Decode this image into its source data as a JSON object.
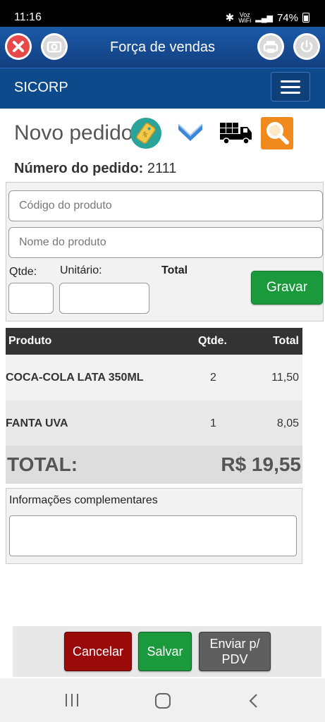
{
  "status_bar": {
    "time": "11:16",
    "network_label": "Voz",
    "wifi_label": "WiFi",
    "battery_percent": "74%"
  },
  "app_bar": {
    "title": "Força de vendas",
    "icons": [
      "close-icon",
      "camera-icon",
      "printer-icon",
      "power-icon"
    ]
  },
  "nav": {
    "brand": "SICORP",
    "menu_icon": "hamburger-icon"
  },
  "page": {
    "title": "Novo pedido",
    "order_label": "Número do pedido:",
    "order_number": "2111",
    "action_icons": [
      "price-tag-icon",
      "chevron-down-icon",
      "delivery-truck-icon",
      "search-icon"
    ]
  },
  "form": {
    "product_code_placeholder": "Código do produto",
    "product_name_placeholder": "Nome do produto",
    "qty_label": "Qtde:",
    "unit_label": "Unitário:",
    "total_label": "Total",
    "save_item_button": "Gravar"
  },
  "table": {
    "headers": {
      "product": "Produto",
      "qty": "Qtde.",
      "total": "Total"
    },
    "rows": [
      {
        "product": "COCA-COLA LATA 350ML",
        "qty": "2",
        "total": "11,50"
      },
      {
        "product": "FANTA UVA",
        "qty": "1",
        "total": "8,05"
      }
    ],
    "grand_total_label": "TOTAL:",
    "grand_total_value": "R$ 19,55"
  },
  "info": {
    "label": "Informações complementares"
  },
  "footer": {
    "cancel": "Cancelar",
    "save": "Salvar",
    "send_line1": "Enviar p/",
    "send_line2": "PDV"
  },
  "colors": {
    "app_bar": "#1b5aa8",
    "nav_bar": "#0d4a8c",
    "cancel": "#9b0a0a",
    "save": "#1a9a3c",
    "send": "#5f5f5f",
    "search_icon_bg": "#f08a1c"
  }
}
